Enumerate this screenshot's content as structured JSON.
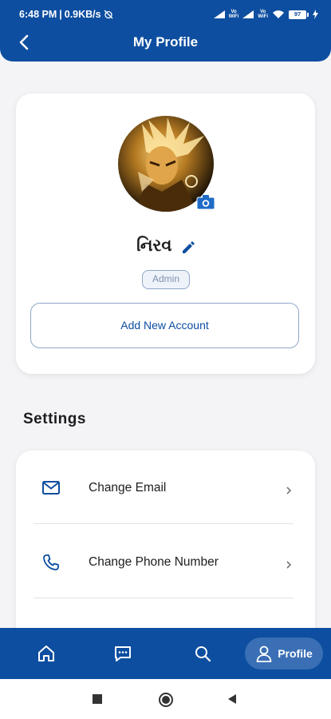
{
  "status_bar": {
    "time": "6:48 PM",
    "net_speed": "0.9KB/s",
    "vowifi_label_1": "Vo\nWiFi",
    "vowifi_label_2": "Vo\nWiFi",
    "battery": "97"
  },
  "header": {
    "title": "My Profile",
    "back_icon": "arrow-left-icon"
  },
  "profile": {
    "name": "નિરવ",
    "role": "Admin",
    "add_account_label": "Add New Account",
    "avatar_icon": "avatar-photo",
    "camera_icon": "camera-icon",
    "edit_icon": "pencil-icon"
  },
  "settings": {
    "heading": "Settings",
    "items": [
      {
        "label": "Change Email",
        "icon": "mail-icon"
      },
      {
        "label": "Change Phone Number",
        "icon": "phone-icon"
      }
    ]
  },
  "bottom_nav": {
    "items": [
      {
        "icon": "home-icon"
      },
      {
        "icon": "chat-icon"
      },
      {
        "icon": "search-icon"
      }
    ],
    "active_label": "Profile",
    "active_icon": "user-icon"
  },
  "colors": {
    "primary": "#0d4ea0",
    "background": "#f4f4f6",
    "card": "#ffffff"
  }
}
